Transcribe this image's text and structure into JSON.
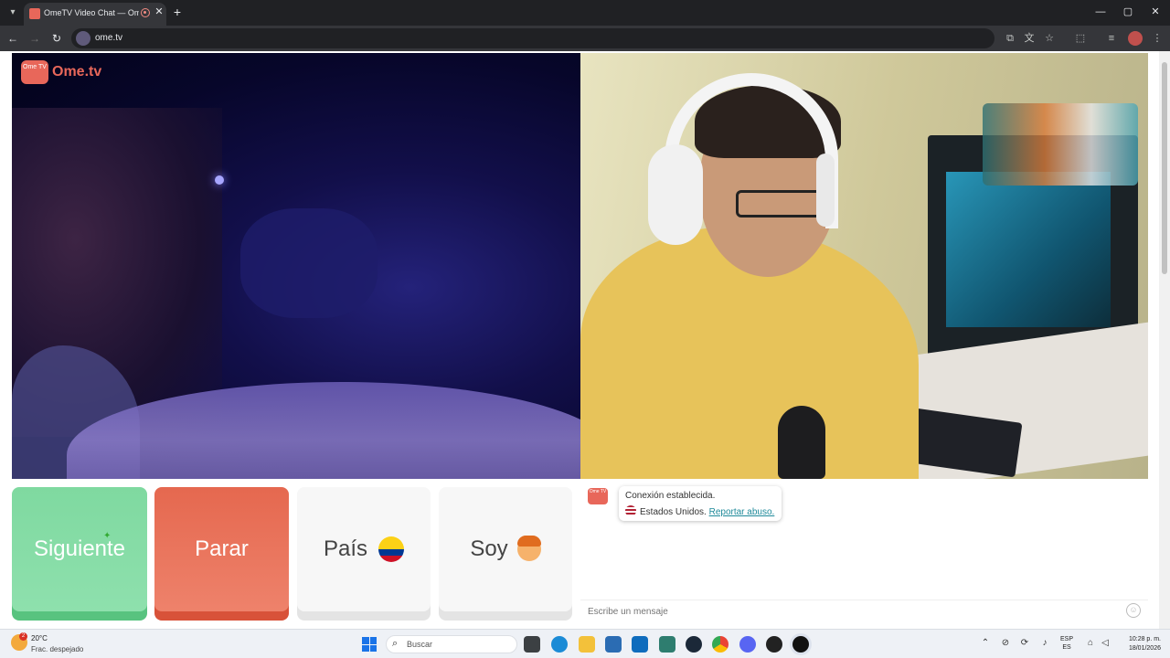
{
  "browser": {
    "tab_title": "OmeTV Video Chat — Ome",
    "tab_close": "✕",
    "new_tab": "+",
    "url": "ome.tv",
    "window_controls": [
      "—",
      "▢",
      "✕"
    ]
  },
  "logo": {
    "badge": "Ome TV",
    "text": "Ome.tv"
  },
  "controls": {
    "next_label": "Siguiente",
    "stop_label": "Parar",
    "country_label": "País",
    "gender_label": "Soy"
  },
  "chat": {
    "system_line1": "Conexión establecida.",
    "system_country": "Estados Unidos.",
    "report_link": "Reportar abuso.",
    "input_placeholder": "Escribe un mensaje"
  },
  "taskbar": {
    "weather_temp": "20°C",
    "weather_desc": "Frac. despejado",
    "weather_badge": "2",
    "search_placeholder": "Buscar",
    "lang_top": "ESP",
    "lang_bottom": "ES",
    "time": "10:28 p. m.",
    "date": "18/01/2026"
  },
  "colors": {
    "next_button": "#8ee0ad",
    "stop_button": "#ee826b",
    "brand": "#e8675a",
    "report_link": "#1f8a9a"
  },
  "icons": {
    "country_flag": "colombia-flag",
    "gender": "boy-emoji",
    "chat_country_flag": "usa-flag"
  }
}
